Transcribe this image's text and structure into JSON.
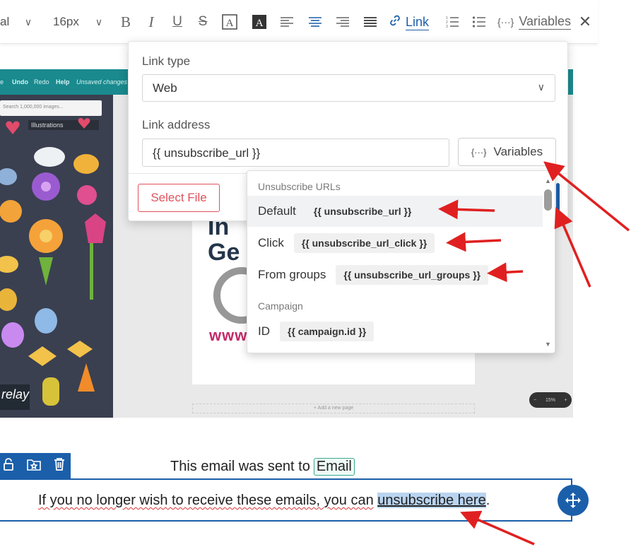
{
  "toolbar": {
    "font_name": "al",
    "font_size": "16px",
    "link_label": "Link",
    "variables_label": "Variables"
  },
  "preview": {
    "topbar": [
      "Undo",
      "Redo",
      "Help",
      "Unsaved changes"
    ],
    "search_placeholder": "Search 1,000,000 images...",
    "illustrations_label": "Illustrations",
    "headline_1": "In",
    "headline_2": "Ge",
    "www": "www",
    "brand": "relay",
    "zoom": "15%",
    "add_page": "+ Add a new page"
  },
  "popup": {
    "link_type_label": "Link type",
    "link_type_value": "Web",
    "link_address_label": "Link address",
    "link_address_value": "{{ unsubscribe_url }}",
    "variables_button": "Variables",
    "select_file_button": "Select File"
  },
  "dropdown": {
    "group1": "Unsubscribe URLs",
    "items": [
      {
        "name": "Default",
        "code": "{{ unsubscribe_url }}"
      },
      {
        "name": "Click",
        "code": "{{ unsubscribe_url_click }}"
      },
      {
        "name": "From groups",
        "code": "{{ unsubscribe_url_groups }}"
      }
    ],
    "group2": "Campaign",
    "campaign_item": {
      "name": "ID",
      "code": "{{ campaign.id }}"
    }
  },
  "email": {
    "sent_to_text": "This email was sent to",
    "email_tag": "Email",
    "footer_before": "If you no longer wish to receive these emails, you can",
    "footer_link": "unsubscribe here",
    "footer_after": "."
  },
  "colors": {
    "accent": "#1b5faa",
    "danger": "#e0525d",
    "arrow": "#e02020"
  }
}
